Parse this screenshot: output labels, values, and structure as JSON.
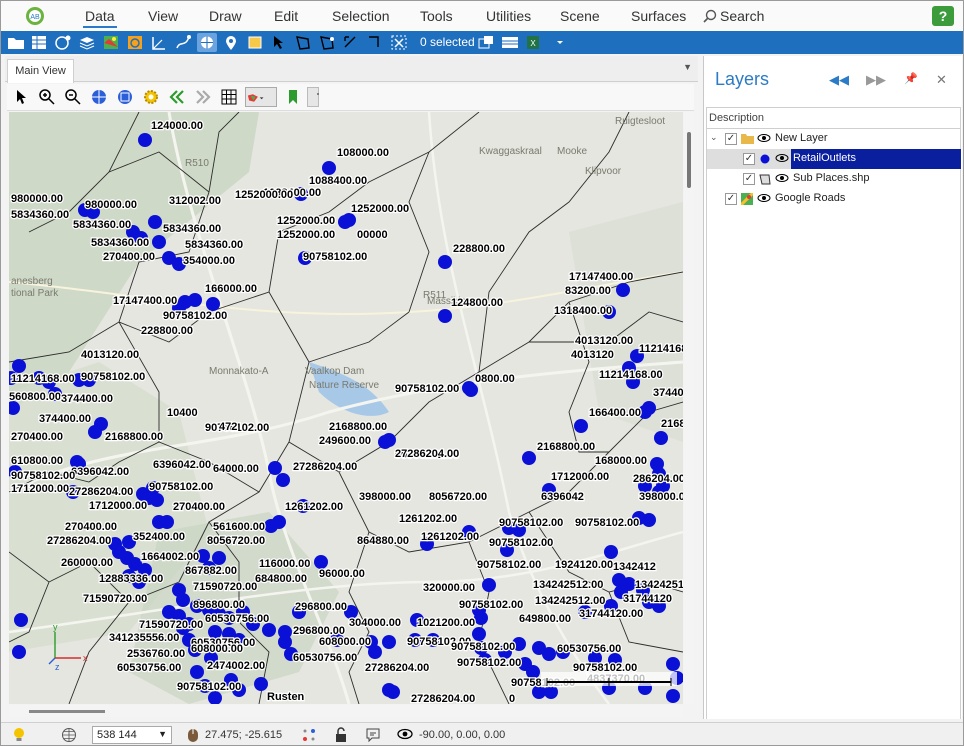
{
  "menu": {
    "items": [
      "Data",
      "View",
      "Draw",
      "Edit",
      "Selection",
      "Tools",
      "Utilities",
      "Scene",
      "Surfaces"
    ],
    "active": "Data",
    "search_label": "Search",
    "help_label": "?"
  },
  "toolbar": {
    "selected_label": "0 selected"
  },
  "document": {
    "tab_label": "Main View"
  },
  "map": {
    "places": [
      {
        "t": "Ruigtesloot"
      },
      {
        "t": "Kwaggaskraal"
      },
      {
        "t": "Mooke"
      },
      {
        "t": "Klipvoor"
      },
      {
        "t": "Massikier"
      },
      {
        "t": "Vaalkop Dam"
      },
      {
        "t": "Nature Reserve"
      },
      {
        "t": "Monnakato-A"
      },
      {
        "t": "anesberg"
      },
      {
        "t": "tional Park"
      },
      {
        "t": "R510"
      },
      {
        "t": "R511"
      }
    ],
    "labels": [
      {
        "t": "124000.00"
      },
      {
        "t": "108000.00"
      },
      {
        "t": "1088400.00"
      },
      {
        "t": "1088400.00"
      },
      {
        "t": "980000.00"
      },
      {
        "t": "980000.00"
      },
      {
        "t": "312002.00"
      },
      {
        "t": "1252000.00"
      },
      {
        "t": "1252000.00"
      },
      {
        "t": "1252000.00"
      },
      {
        "t": "1252000.00"
      },
      {
        "t": "00000"
      },
      {
        "t": "5834360.00"
      },
      {
        "t": "5834360.00"
      },
      {
        "t": "5834360.00"
      },
      {
        "t": "5834360.00"
      },
      {
        "t": "5834360.00"
      },
      {
        "t": "270400.00"
      },
      {
        "t": "354000.00"
      },
      {
        "t": "90758102.00"
      },
      {
        "t": "228800.00"
      },
      {
        "t": "17147400.00"
      },
      {
        "t": "166000.00"
      },
      {
        "t": "17147400.00"
      },
      {
        "t": "90758102.00"
      },
      {
        "t": "124800.00"
      },
      {
        "t": "83200.00"
      },
      {
        "t": "1318400.00"
      },
      {
        "t": "228800.00"
      },
      {
        "t": "4013120.00"
      },
      {
        "t": "4013120"
      },
      {
        "t": "11214168.00"
      },
      {
        "t": "4013120.00"
      },
      {
        "t": "11214168.00"
      },
      {
        "t": "11214168.00"
      },
      {
        "t": "90758102.00"
      },
      {
        "t": "90758102.00"
      },
      {
        "t": "0800.00"
      },
      {
        "t": "560800.00"
      },
      {
        "t": "374400.00"
      },
      {
        "t": "10400"
      },
      {
        "t": "374400.00"
      },
      {
        "t": "90758102.00"
      },
      {
        "t": "166400.00"
      },
      {
        "t": "374400.00"
      },
      {
        "t": "472"
      },
      {
        "t": "2168800.00"
      },
      {
        "t": "2168800.00"
      },
      {
        "t": "249600.00"
      },
      {
        "t": "270400.00"
      },
      {
        "t": "2168800.00"
      },
      {
        "t": "90758102.00"
      },
      {
        "t": "2168800.00"
      },
      {
        "t": "27286204.00"
      },
      {
        "t": "610800.00"
      },
      {
        "t": "6396042.00"
      },
      {
        "t": "168000.00"
      },
      {
        "t": "64000.00"
      },
      {
        "t": "27286204.00"
      },
      {
        "t": "6396042.00"
      },
      {
        "t": "286204.00"
      },
      {
        "t": "90758102.00"
      },
      {
        "t": "1712000.00"
      },
      {
        "t": "27286204.00"
      },
      {
        "t": "1712000.00"
      },
      {
        "t": "90758102.00"
      },
      {
        "t": "6396042"
      },
      {
        "t": "398000.00"
      },
      {
        "t": "398000.00"
      },
      {
        "t": "8056720.00"
      },
      {
        "t": "270400.00"
      },
      {
        "t": "1712000.00"
      },
      {
        "t": "1261202.00"
      },
      {
        "t": "561600.00"
      },
      {
        "t": "270400.00"
      },
      {
        "t": "1261202.00"
      },
      {
        "t": "90758102.00"
      },
      {
        "t": "1261202.00"
      },
      {
        "t": "27286204.00"
      },
      {
        "t": "352400.00"
      },
      {
        "t": "864880.00"
      },
      {
        "t": "8056720.00"
      },
      {
        "t": "90758102.00"
      },
      {
        "t": "90758102.00"
      },
      {
        "t": "1664002.00"
      },
      {
        "t": "260000.00"
      },
      {
        "t": "116000.00"
      },
      {
        "t": "90758102.00"
      },
      {
        "t": "1924120.00"
      },
      {
        "t": "1342412"
      },
      {
        "t": "867882.00"
      },
      {
        "t": "96000.00"
      },
      {
        "t": "12883336.00"
      },
      {
        "t": "684800.00"
      },
      {
        "t": "134242512.00"
      },
      {
        "t": "134242512"
      },
      {
        "t": "71590720.00"
      },
      {
        "t": "320000.00"
      },
      {
        "t": "31744120"
      },
      {
        "t": "71590720.00"
      },
      {
        "t": "134242512.00"
      },
      {
        "t": "896800.00"
      },
      {
        "t": "296800.00"
      },
      {
        "t": "90758102.00"
      },
      {
        "t": "649800.00"
      },
      {
        "t": "31744120.00"
      },
      {
        "t": "1021200.00"
      },
      {
        "t": "71590720.00"
      },
      {
        "t": "60530756.00"
      },
      {
        "t": "304000.00"
      },
      {
        "t": "341235556.00"
      },
      {
        "t": "60530756.00"
      },
      {
        "t": "296800.00"
      },
      {
        "t": "608000.00"
      },
      {
        "t": "608000.00"
      },
      {
        "t": "90758102.00"
      },
      {
        "t": "90758102.00"
      },
      {
        "t": "60530756.00"
      },
      {
        "t": "27286204.00"
      },
      {
        "t": "2536760.00"
      },
      {
        "t": "60530756.00"
      },
      {
        "t": "90758102.00"
      },
      {
        "t": "60530756.00"
      },
      {
        "t": "90758102.00"
      },
      {
        "t": "2474002.00"
      },
      {
        "t": "90758102.00"
      },
      {
        "t": "4837370.00"
      },
      {
        "t": "27286204.00"
      },
      {
        "t": "90758102.00"
      },
      {
        "t": "Rusten"
      },
      {
        "t": "0"
      }
    ]
  },
  "layers": {
    "title": "Layers",
    "column_header": "Description",
    "items": [
      {
        "label": "New Layer"
      },
      {
        "label": "RetailOutlets"
      },
      {
        "label": "Sub Places.shp"
      },
      {
        "label": "Google Roads"
      }
    ]
  },
  "status": {
    "scale": "538 144",
    "coords": "27.475; -25.615",
    "view_angles": "-90.00, 0.00, 0.00"
  },
  "colors": {
    "accent": "#1f6fbf",
    "point": "#0b10d6",
    "selection": "#0a1f9e"
  }
}
